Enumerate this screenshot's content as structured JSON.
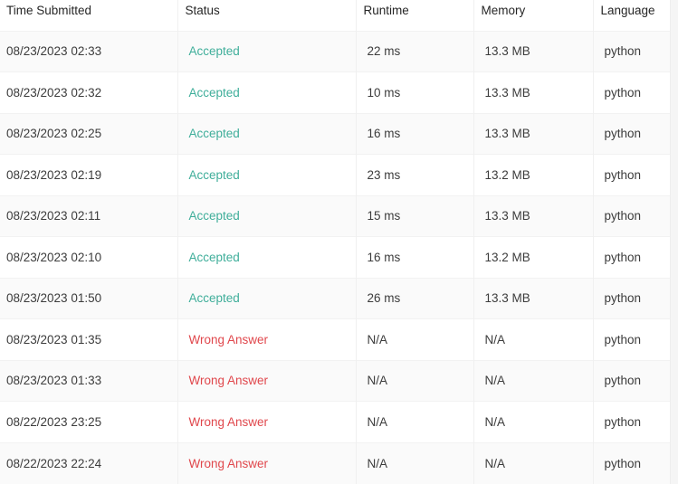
{
  "colors": {
    "accepted": "#3fae9a",
    "wrong_answer": "#e0474c"
  },
  "table": {
    "columns": [
      "Time Submitted",
      "Status",
      "Runtime",
      "Memory",
      "Language"
    ],
    "rows": [
      {
        "time": "08/23/2023 02:33",
        "status": "Accepted",
        "status_type": "accepted",
        "runtime": "22 ms",
        "memory": "13.3 MB",
        "language": "python"
      },
      {
        "time": "08/23/2023 02:32",
        "status": "Accepted",
        "status_type": "accepted",
        "runtime": "10 ms",
        "memory": "13.3 MB",
        "language": "python"
      },
      {
        "time": "08/23/2023 02:25",
        "status": "Accepted",
        "status_type": "accepted",
        "runtime": "16 ms",
        "memory": "13.3 MB",
        "language": "python"
      },
      {
        "time": "08/23/2023 02:19",
        "status": "Accepted",
        "status_type": "accepted",
        "runtime": "23 ms",
        "memory": "13.2 MB",
        "language": "python"
      },
      {
        "time": "08/23/2023 02:11",
        "status": "Accepted",
        "status_type": "accepted",
        "runtime": "15 ms",
        "memory": "13.3 MB",
        "language": "python"
      },
      {
        "time": "08/23/2023 02:10",
        "status": "Accepted",
        "status_type": "accepted",
        "runtime": "16 ms",
        "memory": "13.2 MB",
        "language": "python"
      },
      {
        "time": "08/23/2023 01:50",
        "status": "Accepted",
        "status_type": "accepted",
        "runtime": "26 ms",
        "memory": "13.3 MB",
        "language": "python"
      },
      {
        "time": "08/23/2023 01:35",
        "status": "Wrong Answer",
        "status_type": "wrong",
        "runtime": "N/A",
        "memory": "N/A",
        "language": "python"
      },
      {
        "time": "08/23/2023 01:33",
        "status": "Wrong Answer",
        "status_type": "wrong",
        "runtime": "N/A",
        "memory": "N/A",
        "language": "python"
      },
      {
        "time": "08/22/2023 23:25",
        "status": "Wrong Answer",
        "status_type": "wrong",
        "runtime": "N/A",
        "memory": "N/A",
        "language": "python"
      },
      {
        "time": "08/22/2023 22:24",
        "status": "Wrong Answer",
        "status_type": "wrong",
        "runtime": "N/A",
        "memory": "N/A",
        "language": "python"
      }
    ]
  }
}
